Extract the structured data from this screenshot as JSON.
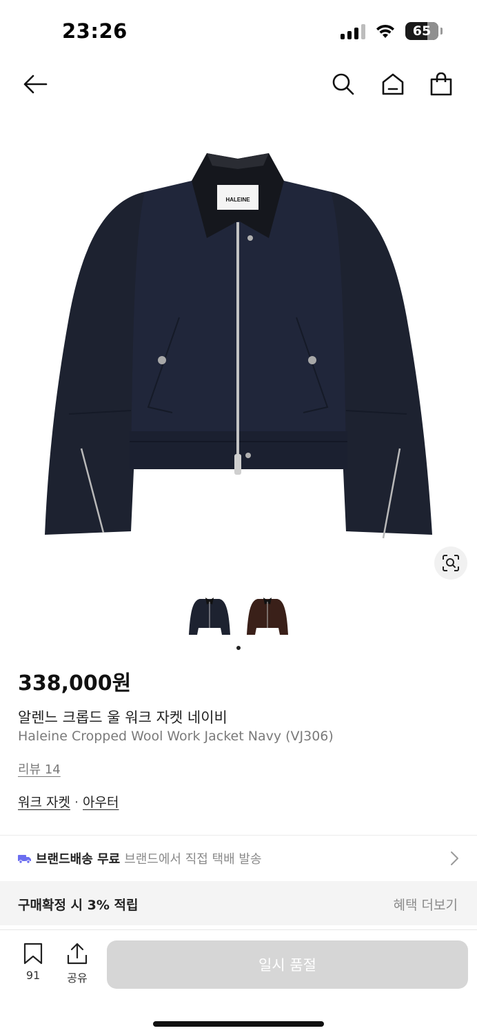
{
  "status_bar": {
    "time": "23:26",
    "battery": "65"
  },
  "nav": {
    "icons": [
      "back-arrow-icon",
      "search-icon",
      "home-icon",
      "shopping-bag-icon"
    ]
  },
  "product": {
    "brand_label": "HALEINE",
    "price": "338,000원",
    "name_ko": "알렌느 크롭드 울 워크 자켓 네이비",
    "name_en": "Haleine Cropped Wool Work Jacket Navy (VJ306)",
    "review": "리뷰 14",
    "category_primary": "워크 자켓",
    "category_separator": "·",
    "category_secondary": "아우터",
    "colors": {
      "navy": "#1d2230",
      "brown": "#3a2019"
    }
  },
  "shipping": {
    "title": "브랜드배송 무료",
    "subtitle": "브랜드에서 직접 택배 발송",
    "accent": "#6b6ef0"
  },
  "benefit": {
    "left": "구매확정 시 3% 적립",
    "right": "혜택 더보기"
  },
  "bottom_bar": {
    "bookmark_count": "91",
    "share_label": "공유",
    "main_button": "일시 품절"
  }
}
